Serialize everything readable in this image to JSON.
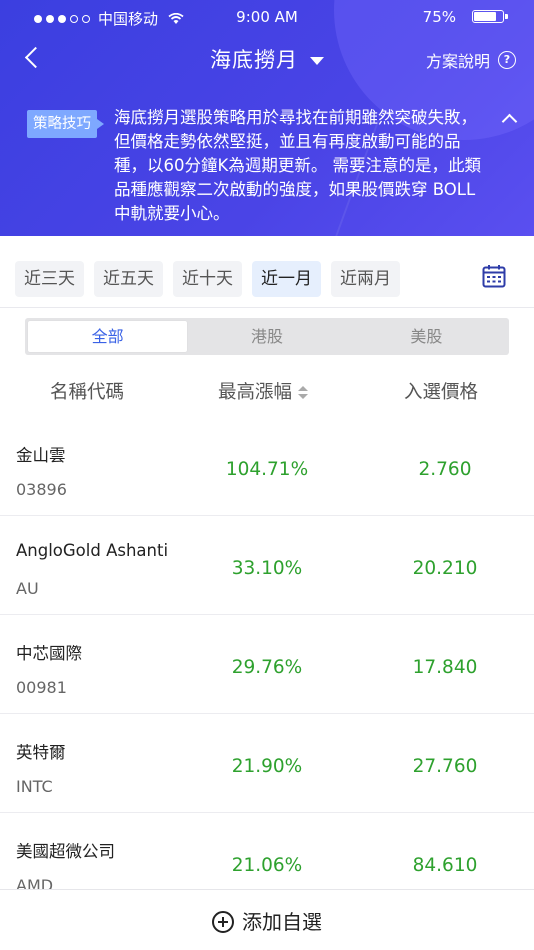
{
  "status_bar": {
    "carrier": "中国移动",
    "time": "9:00 AM",
    "battery": "75%"
  },
  "nav": {
    "title": "海底撈月",
    "plan_desc": "方案說明",
    "help_icon": "question-circle-icon"
  },
  "tips": {
    "tag": "策略技巧",
    "text": "海底撈月選股策略用於尋找在前期雖然突破失敗，但價格走勢依然堅挺，並且有再度啟動可能的品種，以60分鐘K為週期更新。 需要注意的是，此類品種應觀察二次啟動的強度，如果股價跌穿 BOLL 中軌就要小心。"
  },
  "periods": [
    "近三天",
    "近五天",
    "近十天",
    "近一月",
    "近兩月"
  ],
  "active_period": "近一月",
  "markets": [
    "全部",
    "港股",
    "美股"
  ],
  "active_market": "全部",
  "columns": {
    "name": "名稱代碼",
    "gain": "最高漲幅",
    "price": "入選價格"
  },
  "rows": [
    {
      "name": "金山雲",
      "code": "03896",
      "gain": "104.71%",
      "price": "2.760"
    },
    {
      "name": "AngloGold Ashanti",
      "code": "AU",
      "gain": "33.10%",
      "price": "20.210"
    },
    {
      "name": "中芯國際",
      "code": "00981",
      "gain": "29.76%",
      "price": "17.840"
    },
    {
      "name": "英特爾",
      "code": "INTC",
      "gain": "21.90%",
      "price": "27.760"
    },
    {
      "name": "美國超微公司",
      "code": "AMD",
      "gain": "21.06%",
      "price": "84.610"
    }
  ],
  "bottom": {
    "add_label": "添加自選"
  },
  "colors": {
    "header": "#4a44e6",
    "accent": "#3a62e6",
    "gain": "#2ea12e"
  }
}
